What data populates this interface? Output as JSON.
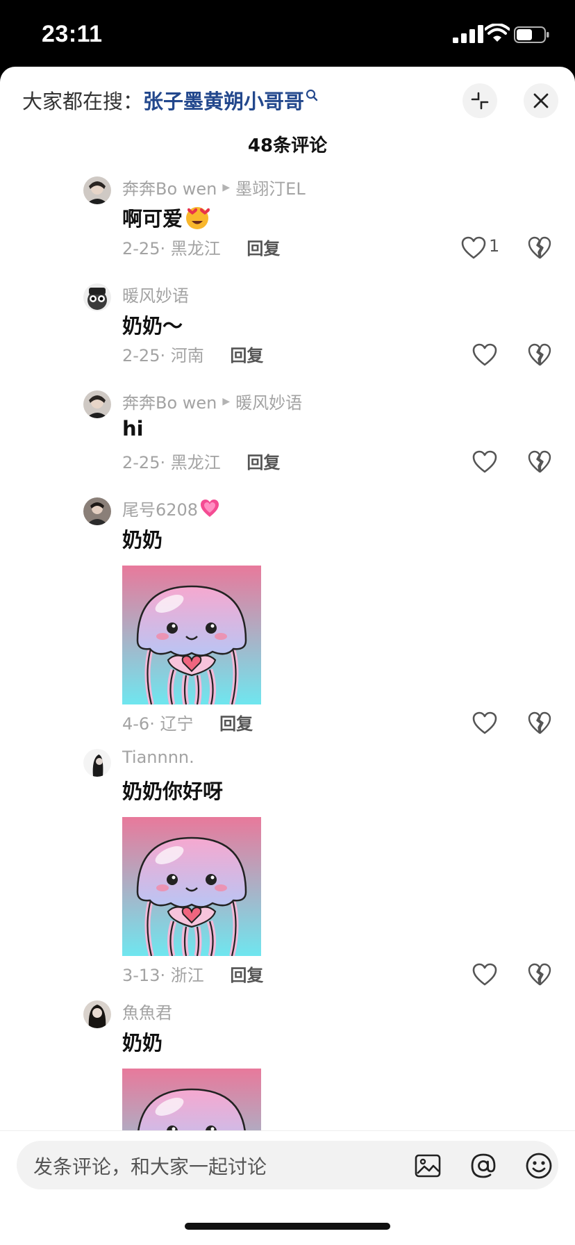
{
  "status": {
    "time": "23:11"
  },
  "header": {
    "search_prefix": "大家都在搜：",
    "search_term": "张子墨黄朔小哥哥",
    "comment_count": "48条评论"
  },
  "comments": [
    {
      "user": "奔奔Bo wen",
      "reply_to": "墨翊汀EL",
      "text": "啊可爱",
      "date": "2-25",
      "location": "黑龙江",
      "reply_label": "回复",
      "likes": "1"
    },
    {
      "user": "暖风妙语",
      "text": "奶奶～",
      "date": "2-25",
      "location": "河南",
      "reply_label": "回复"
    },
    {
      "user": "奔奔Bo wen",
      "reply_to": "暖风妙语",
      "text": "hi",
      "date": "2-25",
      "location": "黑龙江",
      "reply_label": "回复"
    },
    {
      "user": "尾号6208",
      "text": "奶奶",
      "date": "4-6",
      "location": "辽宁",
      "reply_label": "回复",
      "sticker": "jellyfish-heart"
    },
    {
      "user": "Tiannnn.",
      "text": "奶奶你好呀",
      "date": "3-13",
      "location": "浙江",
      "reply_label": "回复",
      "sticker": "jellyfish-heart"
    },
    {
      "user": "魚魚君",
      "text": "奶奶",
      "sticker": "jellyfish-heart"
    }
  ],
  "composer": {
    "placeholder": "发条评论，和大家一起讨论"
  },
  "icons": [
    "signal-icon",
    "wifi-icon",
    "battery-icon",
    "search-icon",
    "collapse-icon",
    "close-icon",
    "heart-icon",
    "broken-heart-icon",
    "image-icon",
    "at-icon",
    "emoji-icon"
  ],
  "colors": {
    "search_term": "#23488d",
    "muted": "#a3a3a3",
    "sticker_top": "#e87a9a",
    "sticker_bottom": "#6fe3ef"
  }
}
